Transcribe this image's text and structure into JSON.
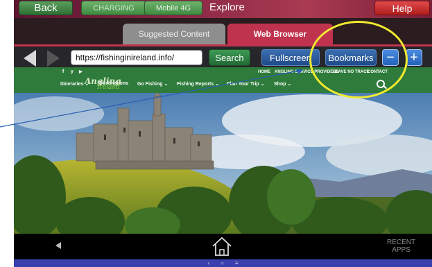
{
  "topbar": {
    "back_label": "Back",
    "charging_label": "CHARGING",
    "network_label": "Mobile 4G",
    "title": "Explore",
    "help_label": "Help"
  },
  "tabs": [
    {
      "label": "Suggested Content",
      "active": false
    },
    {
      "label": "Web Browser",
      "active": true
    }
  ],
  "urlbar": {
    "url": "https://fishinginireland.info/",
    "search_label": "Search",
    "fullscreen_label": "Fullscreen",
    "bookmarks_label": "Bookmarks",
    "zoom_out_label": "−",
    "zoom_in_label": "+"
  },
  "website": {
    "social_icons": [
      "f",
      "y",
      "▶"
    ],
    "top_links": [
      "HOME",
      "ANGLING SERVICE PROVIDERS",
      "LEAVE NO TRACE",
      "CONTACT"
    ],
    "menu": [
      "Itineraries ⌄",
      "Destinations",
      "Go Fishing ⌄",
      "Fishing Reports ⌄",
      "Plan Your Trip ⌄",
      "Shop ⌄"
    ],
    "logo_main": "Angling",
    "logo_sub": "Ireland"
  },
  "system_nav": {
    "recent_apps_label": "RECENT\nAPPS",
    "bottom_glyphs": [
      "‹",
      "○",
      "≡"
    ]
  },
  "colors": {
    "accent": "#c0334e",
    "site_green": "#2e7b3b",
    "highlight": "#f1ea30",
    "button_blue": "#2362b8"
  }
}
